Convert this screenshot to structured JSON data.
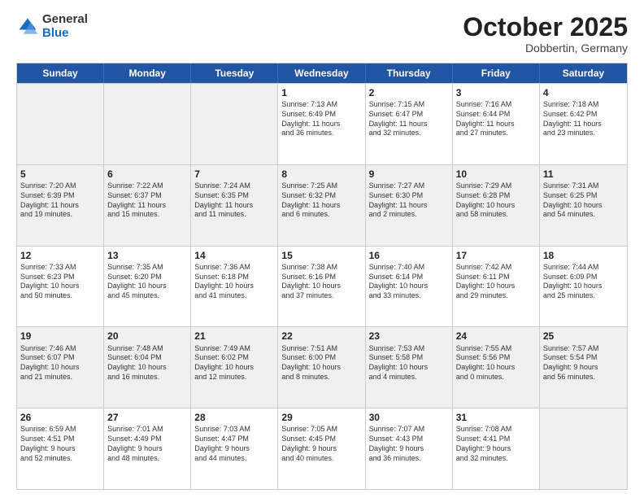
{
  "logo": {
    "general": "General",
    "blue": "Blue"
  },
  "title": "October 2025",
  "location": "Dobbertin, Germany",
  "header_days": [
    "Sunday",
    "Monday",
    "Tuesday",
    "Wednesday",
    "Thursday",
    "Friday",
    "Saturday"
  ],
  "weeks": [
    [
      {
        "day": "",
        "info": ""
      },
      {
        "day": "",
        "info": ""
      },
      {
        "day": "",
        "info": ""
      },
      {
        "day": "1",
        "info": "Sunrise: 7:13 AM\nSunset: 6:49 PM\nDaylight: 11 hours\nand 36 minutes."
      },
      {
        "day": "2",
        "info": "Sunrise: 7:15 AM\nSunset: 6:47 PM\nDaylight: 11 hours\nand 32 minutes."
      },
      {
        "day": "3",
        "info": "Sunrise: 7:16 AM\nSunset: 6:44 PM\nDaylight: 11 hours\nand 27 minutes."
      },
      {
        "day": "4",
        "info": "Sunrise: 7:18 AM\nSunset: 6:42 PM\nDaylight: 11 hours\nand 23 minutes."
      }
    ],
    [
      {
        "day": "5",
        "info": "Sunrise: 7:20 AM\nSunset: 6:39 PM\nDaylight: 11 hours\nand 19 minutes."
      },
      {
        "day": "6",
        "info": "Sunrise: 7:22 AM\nSunset: 6:37 PM\nDaylight: 11 hours\nand 15 minutes."
      },
      {
        "day": "7",
        "info": "Sunrise: 7:24 AM\nSunset: 6:35 PM\nDaylight: 11 hours\nand 11 minutes."
      },
      {
        "day": "8",
        "info": "Sunrise: 7:25 AM\nSunset: 6:32 PM\nDaylight: 11 hours\nand 6 minutes."
      },
      {
        "day": "9",
        "info": "Sunrise: 7:27 AM\nSunset: 6:30 PM\nDaylight: 11 hours\nand 2 minutes."
      },
      {
        "day": "10",
        "info": "Sunrise: 7:29 AM\nSunset: 6:28 PM\nDaylight: 10 hours\nand 58 minutes."
      },
      {
        "day": "11",
        "info": "Sunrise: 7:31 AM\nSunset: 6:25 PM\nDaylight: 10 hours\nand 54 minutes."
      }
    ],
    [
      {
        "day": "12",
        "info": "Sunrise: 7:33 AM\nSunset: 6:23 PM\nDaylight: 10 hours\nand 50 minutes."
      },
      {
        "day": "13",
        "info": "Sunrise: 7:35 AM\nSunset: 6:20 PM\nDaylight: 10 hours\nand 45 minutes."
      },
      {
        "day": "14",
        "info": "Sunrise: 7:36 AM\nSunset: 6:18 PM\nDaylight: 10 hours\nand 41 minutes."
      },
      {
        "day": "15",
        "info": "Sunrise: 7:38 AM\nSunset: 6:16 PM\nDaylight: 10 hours\nand 37 minutes."
      },
      {
        "day": "16",
        "info": "Sunrise: 7:40 AM\nSunset: 6:14 PM\nDaylight: 10 hours\nand 33 minutes."
      },
      {
        "day": "17",
        "info": "Sunrise: 7:42 AM\nSunset: 6:11 PM\nDaylight: 10 hours\nand 29 minutes."
      },
      {
        "day": "18",
        "info": "Sunrise: 7:44 AM\nSunset: 6:09 PM\nDaylight: 10 hours\nand 25 minutes."
      }
    ],
    [
      {
        "day": "19",
        "info": "Sunrise: 7:46 AM\nSunset: 6:07 PM\nDaylight: 10 hours\nand 21 minutes."
      },
      {
        "day": "20",
        "info": "Sunrise: 7:48 AM\nSunset: 6:04 PM\nDaylight: 10 hours\nand 16 minutes."
      },
      {
        "day": "21",
        "info": "Sunrise: 7:49 AM\nSunset: 6:02 PM\nDaylight: 10 hours\nand 12 minutes."
      },
      {
        "day": "22",
        "info": "Sunrise: 7:51 AM\nSunset: 6:00 PM\nDaylight: 10 hours\nand 8 minutes."
      },
      {
        "day": "23",
        "info": "Sunrise: 7:53 AM\nSunset: 5:58 PM\nDaylight: 10 hours\nand 4 minutes."
      },
      {
        "day": "24",
        "info": "Sunrise: 7:55 AM\nSunset: 5:56 PM\nDaylight: 10 hours\nand 0 minutes."
      },
      {
        "day": "25",
        "info": "Sunrise: 7:57 AM\nSunset: 5:54 PM\nDaylight: 9 hours\nand 56 minutes."
      }
    ],
    [
      {
        "day": "26",
        "info": "Sunrise: 6:59 AM\nSunset: 4:51 PM\nDaylight: 9 hours\nand 52 minutes."
      },
      {
        "day": "27",
        "info": "Sunrise: 7:01 AM\nSunset: 4:49 PM\nDaylight: 9 hours\nand 48 minutes."
      },
      {
        "day": "28",
        "info": "Sunrise: 7:03 AM\nSunset: 4:47 PM\nDaylight: 9 hours\nand 44 minutes."
      },
      {
        "day": "29",
        "info": "Sunrise: 7:05 AM\nSunset: 4:45 PM\nDaylight: 9 hours\nand 40 minutes."
      },
      {
        "day": "30",
        "info": "Sunrise: 7:07 AM\nSunset: 4:43 PM\nDaylight: 9 hours\nand 36 minutes."
      },
      {
        "day": "31",
        "info": "Sunrise: 7:08 AM\nSunset: 4:41 PM\nDaylight: 9 hours\nand 32 minutes."
      },
      {
        "day": "",
        "info": ""
      }
    ]
  ]
}
